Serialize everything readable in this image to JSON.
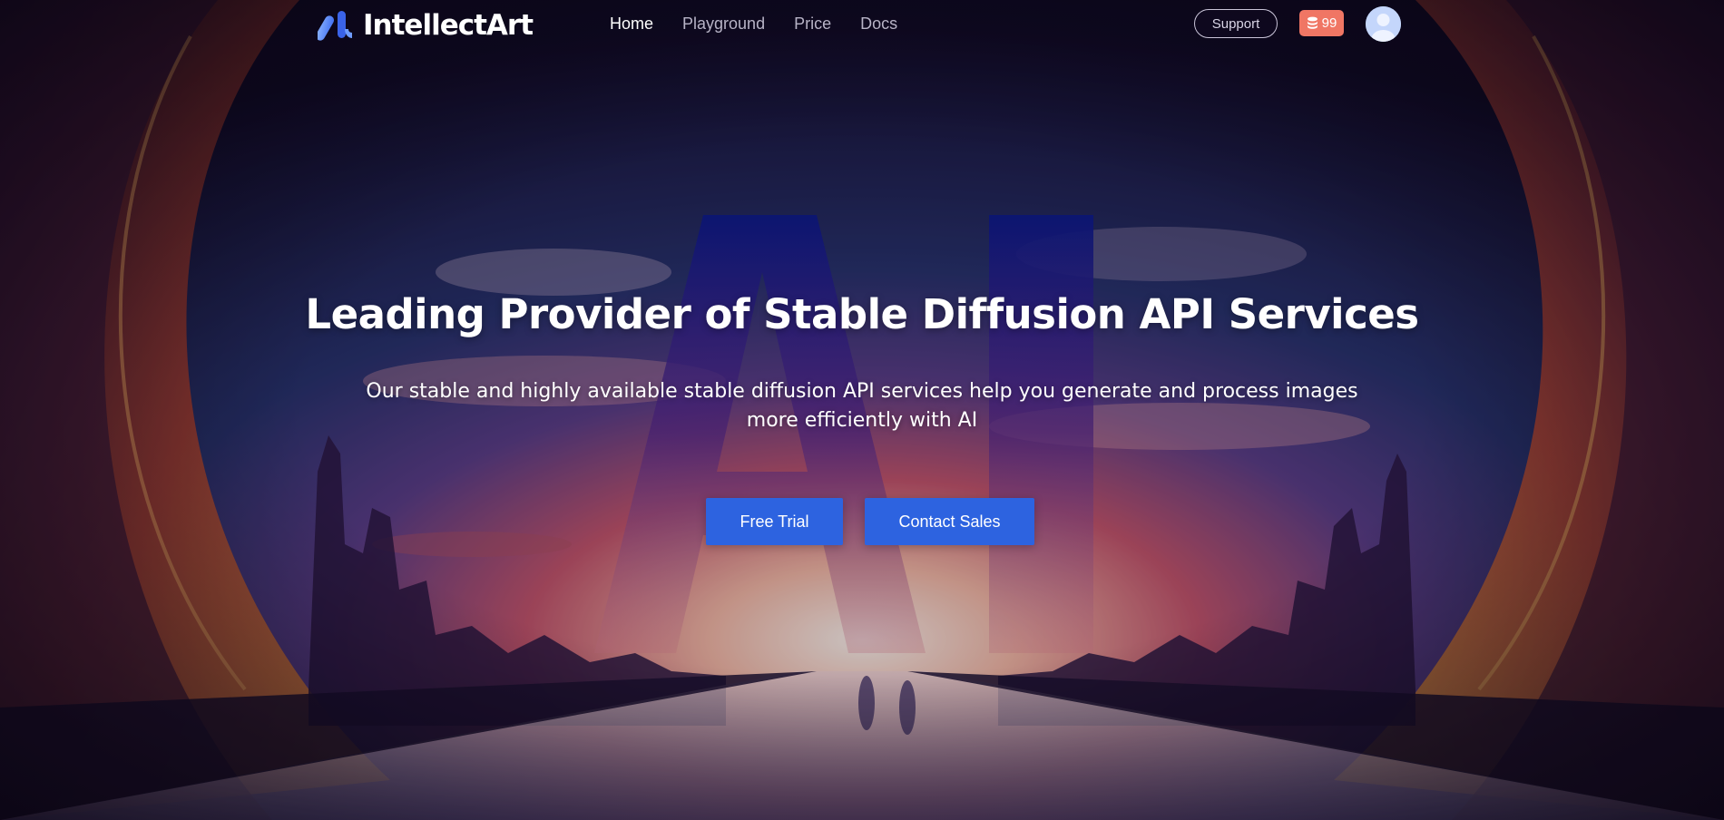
{
  "brand": {
    "name": "IntellectArt",
    "name_part1": "Intellect",
    "name_part2": "Art"
  },
  "nav": {
    "items": [
      {
        "label": "Home",
        "active": true
      },
      {
        "label": "Playground",
        "active": false
      },
      {
        "label": "Price",
        "active": false
      },
      {
        "label": "Docs",
        "active": false
      }
    ]
  },
  "header": {
    "support_label": "Support",
    "credits": "99",
    "credits_icon": "coin-stack-icon",
    "avatar_icon": "user-avatar-icon"
  },
  "hero": {
    "title": "Leading Provider of Stable Diffusion API Services",
    "subtitle": "Our stable and highly available stable diffusion API services help you generate and process images more efficiently with AI",
    "background_text": "AI",
    "buttons": {
      "free_trial": "Free Trial",
      "contact_sales": "Contact Sales"
    }
  },
  "colors": {
    "accent_blue": "#2d63e0",
    "credits_badge": "#f07664",
    "nav_active": "#ffffff",
    "nav_inactive": "#b7b3c6"
  }
}
